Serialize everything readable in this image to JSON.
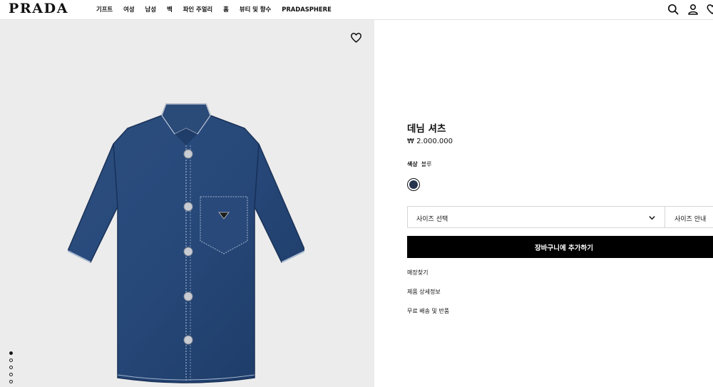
{
  "header": {
    "logo": "PRADA",
    "nav": [
      "기프트",
      "여성",
      "남성",
      "백",
      "파인 주얼리",
      "홈",
      "뷰티 및 향수",
      "PRADASPHERE"
    ],
    "icons": [
      "search-icon",
      "user-icon",
      "heart-icon"
    ]
  },
  "gallery": {
    "favorite_icon": "heart-icon",
    "image": "denim-shirt",
    "dots_count": 5,
    "active_dot": 1
  },
  "product": {
    "title": "데님 셔츠",
    "price": "₩ 2.000.000",
    "color_label": "색상",
    "color_value": "블루",
    "swatch_color": "#26344d",
    "size_select": "사이즈 선택",
    "size_guide": "사이즈 안내",
    "add_to_cart": "장바구니에 추가하기",
    "links": [
      "매장찾기",
      "제품 상세정보",
      "무료 배송 및 반품"
    ]
  }
}
